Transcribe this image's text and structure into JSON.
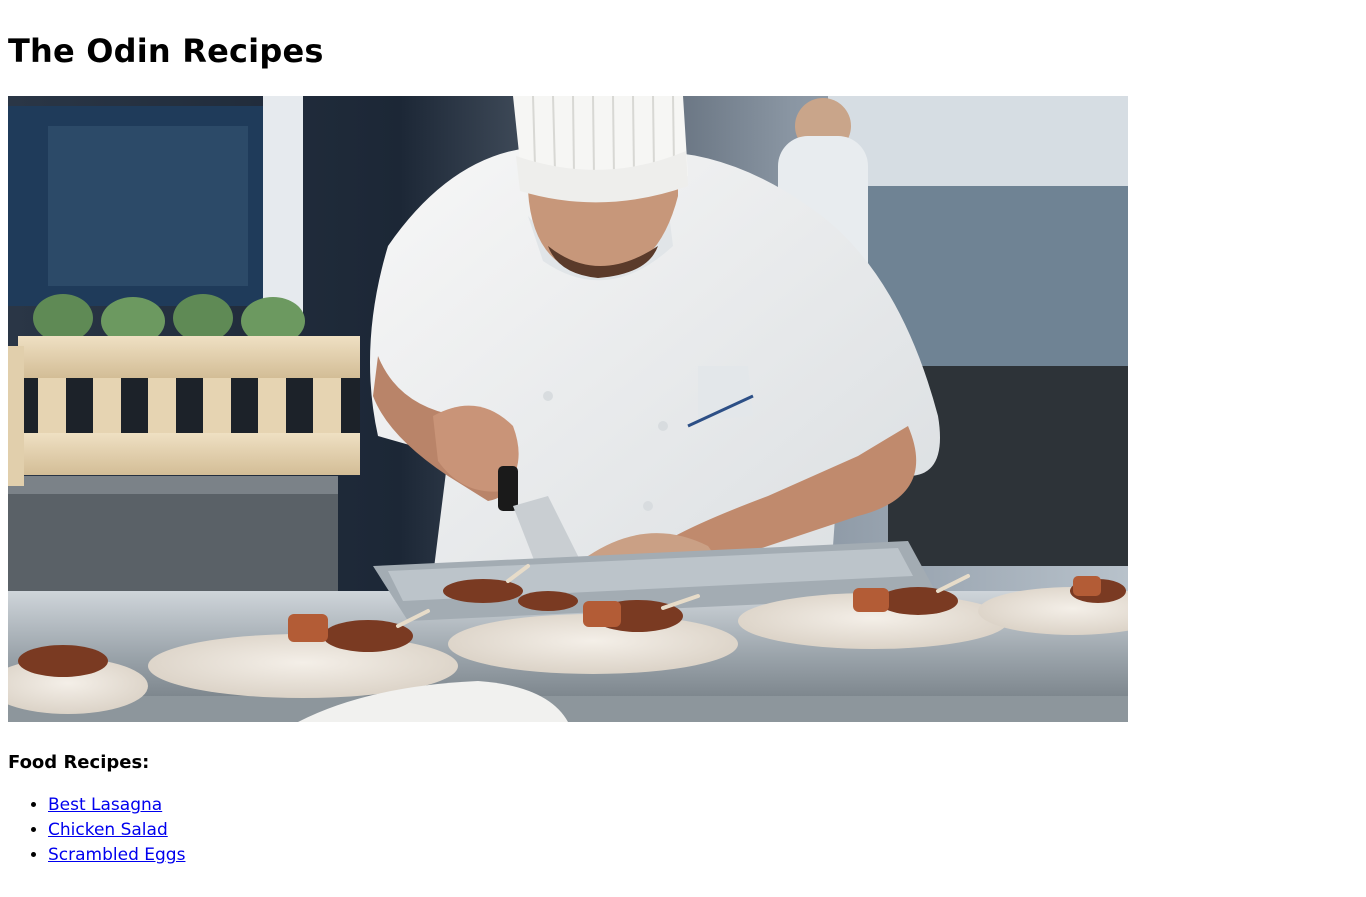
{
  "page": {
    "title": "The Odin Recipes"
  },
  "hero_image": {
    "alt": "Chef plating dishes in a professional kitchen"
  },
  "recipes_section": {
    "heading": "Food Recipes:",
    "items": [
      {
        "label": "Best Lasagna"
      },
      {
        "label": "Chicken Salad"
      },
      {
        "label": "Scrambled Eggs"
      }
    ]
  },
  "colors": {
    "link": "#0000ee",
    "text": "#000000",
    "background": "#ffffff"
  }
}
